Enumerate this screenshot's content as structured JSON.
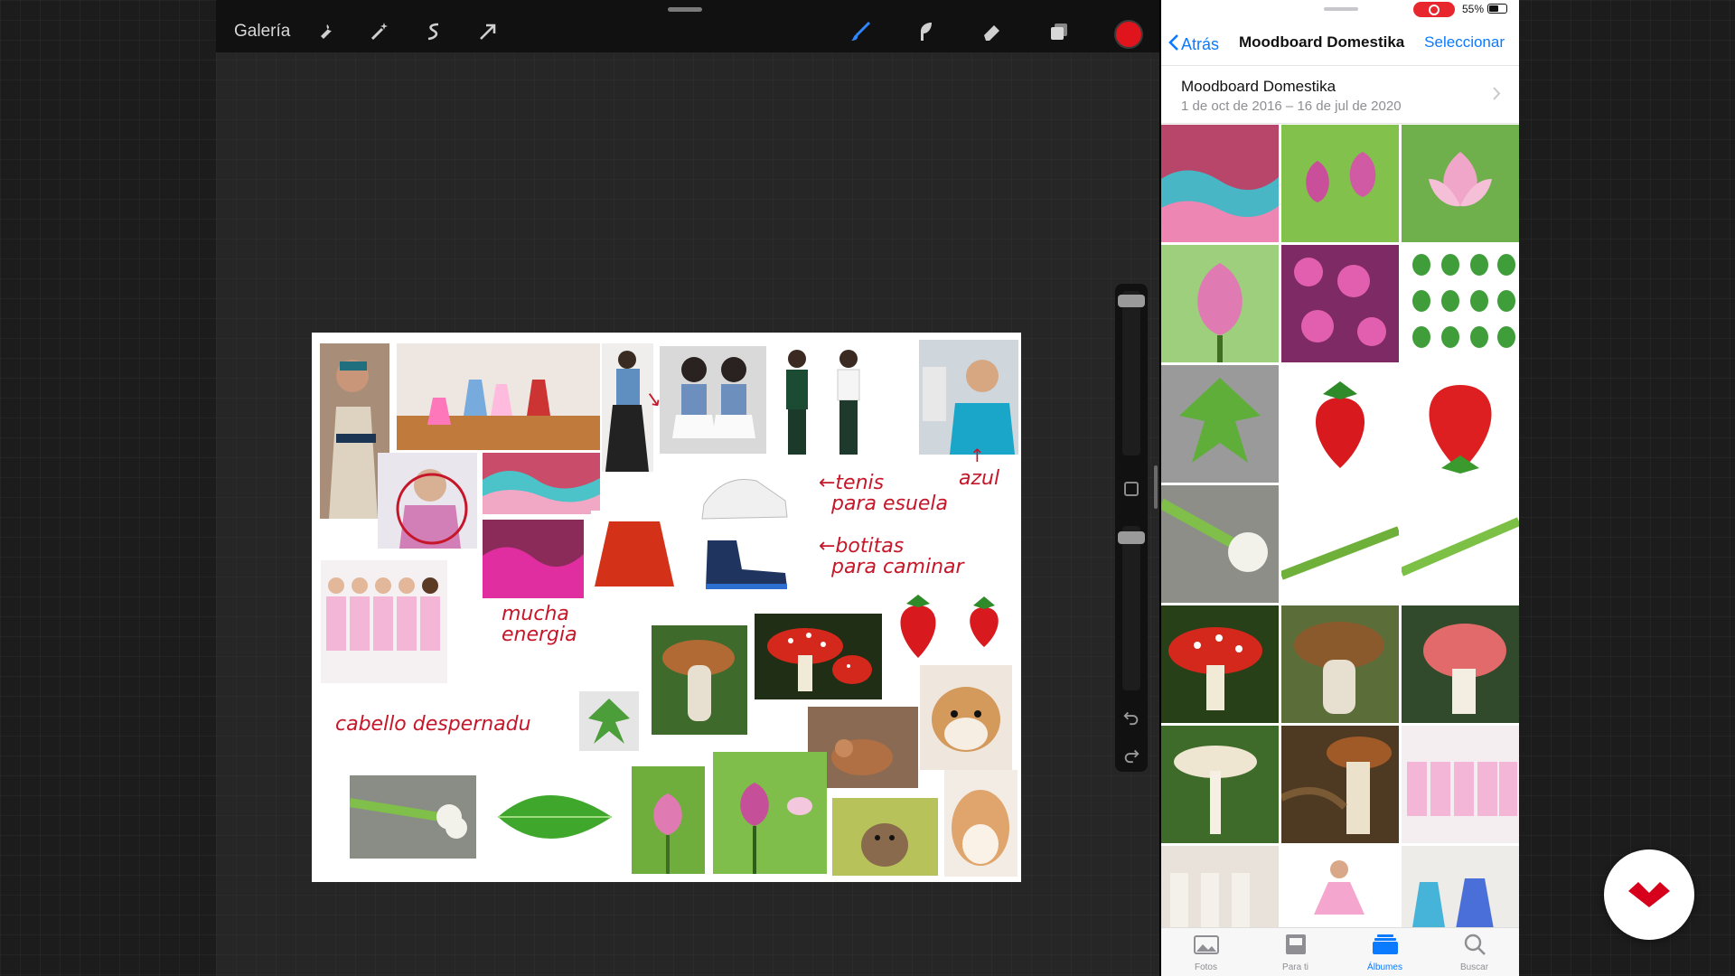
{
  "procreate": {
    "gallery_label": "Galería",
    "tools_left": [
      "wrench-icon",
      "magic-wand-icon",
      "selection-icon",
      "transform-arrow-icon"
    ],
    "tools_right": [
      "brush-icon",
      "smudge-icon",
      "eraser-icon",
      "layers-icon"
    ],
    "current_color": "#e0141c",
    "canvas": {
      "annotations": {
        "tenis": "←tenis\n  para esuela",
        "botitas": "←botitas\n  para caminar",
        "azul": "azul",
        "energia": "mucha\nenergia",
        "cabello": "cabello despernadu"
      }
    }
  },
  "photos": {
    "status": {
      "battery": "55%"
    },
    "back_label": "Atrás",
    "title": "Moodboard Domestika",
    "select_label": "Seleccionar",
    "album_name": "Moodboard Domestika",
    "album_dates": "1 de oct de 2016 – 16 de jul de 2020",
    "grid": [
      "dancers-skirts",
      "lotus-buds",
      "lotus-flower",
      "lotus-bud",
      "pink-flowers",
      "leaves-chart",
      "green-leaf",
      "strawberry-small",
      "strawberry",
      "onion",
      "onion-stem",
      "onion-stem-2",
      "amanita",
      "porcini",
      "pink-mushroom",
      "white-mushroom",
      "mushroom-basket",
      "ballet-kids",
      "ballet-class",
      "ballet-girl",
      "ballet-dancers"
    ],
    "tabs": [
      {
        "label": "Fotos",
        "icon": "photos-icon",
        "active": false
      },
      {
        "label": "Para ti",
        "icon": "for-you-icon",
        "active": false
      },
      {
        "label": "Álbumes",
        "icon": "albums-icon",
        "active": true
      },
      {
        "label": "Buscar",
        "icon": "search-icon",
        "active": false
      }
    ],
    "accent": "#0a7aff"
  },
  "brand": {
    "logo": "domestika-logo",
    "color": "#d6001c"
  }
}
